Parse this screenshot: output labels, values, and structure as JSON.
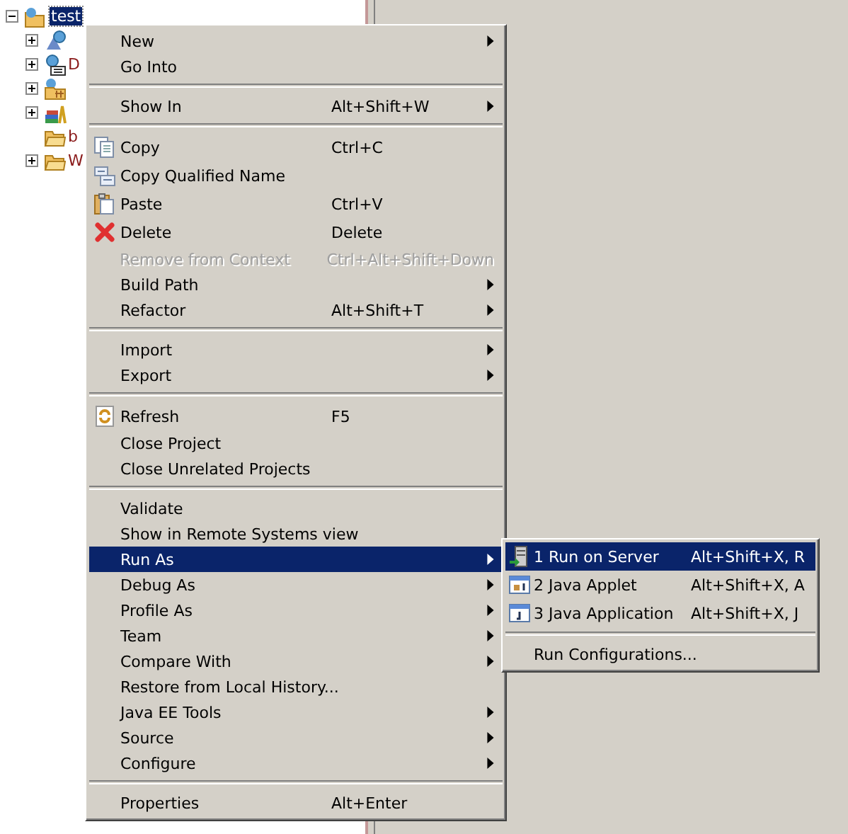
{
  "tree": {
    "label": "test",
    "selected": true,
    "expanded": true,
    "children": [
      {
        "kind": "service",
        "expanded": false
      },
      {
        "kind": "web-module",
        "label": "D",
        "expanded": false
      },
      {
        "kind": "package-folder",
        "expanded": false
      },
      {
        "kind": "library",
        "expanded": false
      },
      {
        "kind": "folder",
        "label": "b"
      },
      {
        "kind": "folder",
        "label": "W",
        "expanded": false
      }
    ]
  },
  "context_menu": {
    "items": [
      {
        "kind": "plain",
        "label": "New",
        "submenu": true
      },
      {
        "kind": "plain",
        "label": "Go Into"
      },
      {
        "kind": "separator"
      },
      {
        "kind": "plain",
        "label": "Show In",
        "shortcut": "Alt+Shift+W",
        "submenu": true
      },
      {
        "kind": "separator"
      },
      {
        "kind": "copy",
        "label": "Copy",
        "shortcut": "Ctrl+C"
      },
      {
        "kind": "copy-qualified",
        "label": "Copy Qualified Name"
      },
      {
        "kind": "paste",
        "label": "Paste",
        "shortcut": "Ctrl+V"
      },
      {
        "kind": "delete",
        "label": "Delete",
        "shortcut": "Delete"
      },
      {
        "kind": "plain",
        "label": "Remove from Context",
        "shortcut": "Ctrl+Alt+Shift+Down",
        "disabled": true
      },
      {
        "kind": "plain",
        "label": "Build Path",
        "submenu": true
      },
      {
        "kind": "plain",
        "label": "Refactor",
        "shortcut": "Alt+Shift+T",
        "submenu": true
      },
      {
        "kind": "separator"
      },
      {
        "kind": "plain",
        "label": "Import",
        "submenu": true
      },
      {
        "kind": "plain",
        "label": "Export",
        "submenu": true
      },
      {
        "kind": "separator"
      },
      {
        "kind": "refresh",
        "label": "Refresh",
        "shortcut": "F5"
      },
      {
        "kind": "plain",
        "label": "Close Project"
      },
      {
        "kind": "plain",
        "label": "Close Unrelated Projects"
      },
      {
        "kind": "separator"
      },
      {
        "kind": "plain",
        "label": "Validate"
      },
      {
        "kind": "plain",
        "label": "Show in Remote Systems view"
      },
      {
        "kind": "plain",
        "label": "Run As",
        "submenu": true,
        "selected": true
      },
      {
        "kind": "plain",
        "label": "Debug As",
        "submenu": true
      },
      {
        "kind": "plain",
        "label": "Profile As",
        "submenu": true
      },
      {
        "kind": "plain",
        "label": "Team",
        "submenu": true
      },
      {
        "kind": "plain",
        "label": "Compare With",
        "submenu": true
      },
      {
        "kind": "plain",
        "label": "Restore from Local History..."
      },
      {
        "kind": "plain",
        "label": "Java EE Tools",
        "submenu": true
      },
      {
        "kind": "plain",
        "label": "Source",
        "submenu": true
      },
      {
        "kind": "plain",
        "label": "Configure",
        "submenu": true
      },
      {
        "kind": "separator"
      },
      {
        "kind": "plain",
        "label": "Properties",
        "shortcut": "Alt+Enter"
      }
    ]
  },
  "run_as_submenu": {
    "items": [
      {
        "kind": "server",
        "label": "1 Run on Server",
        "shortcut": "Alt+Shift+X, R",
        "selected": true
      },
      {
        "kind": "applet",
        "label": "2 Java Applet",
        "shortcut": "Alt+Shift+X, A",
        "selected": false
      },
      {
        "kind": "application",
        "label": "3 Java Application",
        "shortcut": "Alt+Shift+X, J",
        "selected": false
      },
      {
        "kind": "separator"
      },
      {
        "kind": "plain",
        "label": "Run Configurations...",
        "selected": false
      }
    ]
  }
}
